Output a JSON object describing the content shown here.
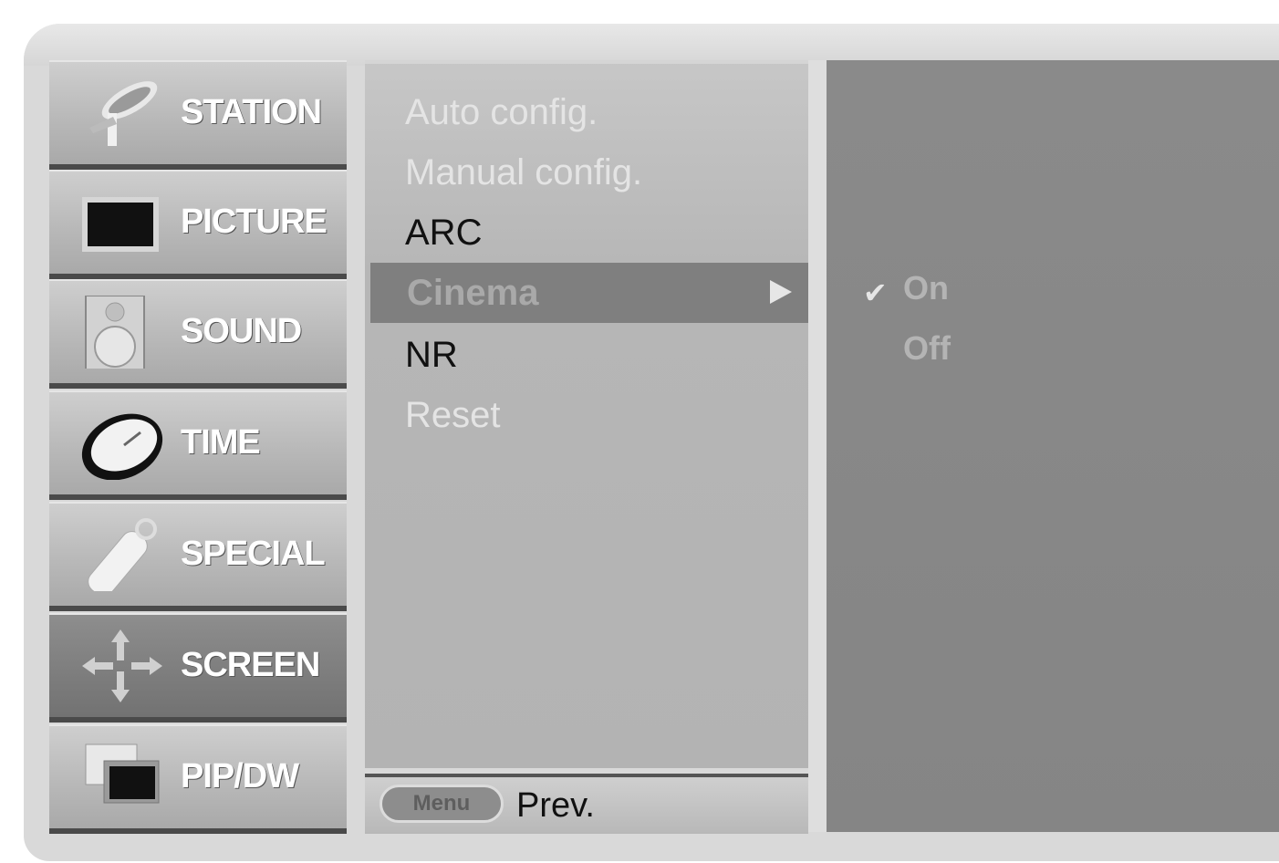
{
  "sidebar": {
    "items": [
      {
        "label": "STATION",
        "icon": "satellite-dish-icon"
      },
      {
        "label": "PICTURE",
        "icon": "tv-screen-icon"
      },
      {
        "label": "SOUND",
        "icon": "speaker-icon"
      },
      {
        "label": "TIME",
        "icon": "clock-icon"
      },
      {
        "label": "SPECIAL",
        "icon": "remote-control-icon"
      },
      {
        "label": "SCREEN",
        "icon": "move-arrows-icon",
        "active": true
      },
      {
        "label": "PIP/DW",
        "icon": "pip-windows-icon"
      }
    ]
  },
  "submenu": {
    "items": [
      {
        "label": "Auto config.",
        "state": "dim"
      },
      {
        "label": "Manual config.",
        "state": "dim"
      },
      {
        "label": "ARC",
        "state": "normal"
      },
      {
        "label": "Cinema",
        "state": "selected"
      },
      {
        "label": "NR",
        "state": "normal"
      },
      {
        "label": "Reset",
        "state": "dim"
      }
    ],
    "footer": {
      "button": "Menu",
      "label": "Prev."
    }
  },
  "options": {
    "items": [
      {
        "label": "On",
        "checked": true
      },
      {
        "label": "Off",
        "checked": false
      }
    ],
    "check_mark": "✔"
  }
}
